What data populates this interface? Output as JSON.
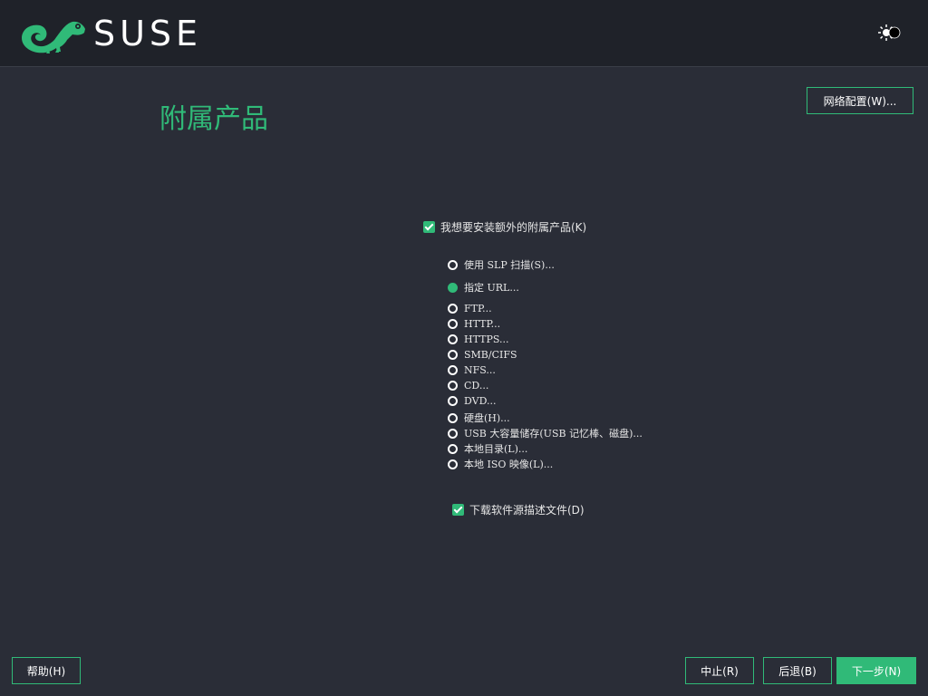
{
  "header": {
    "brand": "SUSE",
    "logo_icon": "chameleon-logo-icon",
    "theme_toggle_icon": "sun-moon-toggle-icon"
  },
  "page": {
    "title": "附属产品",
    "network_button": "网络配置(W)..."
  },
  "addon": {
    "install_checkbox": {
      "label": "我想要安装额外的附属产品(K)",
      "checked": true
    },
    "options_primary": [
      {
        "label": "使用 SLP 扫描(S)...",
        "selected": false
      },
      {
        "label": "指定 URL...",
        "selected": true
      }
    ],
    "options": [
      {
        "label": "FTP...",
        "selected": false
      },
      {
        "label": "HTTP...",
        "selected": false
      },
      {
        "label": "HTTPS...",
        "selected": false
      },
      {
        "label": "SMB/CIFS",
        "selected": false
      },
      {
        "label": "NFS...",
        "selected": false
      },
      {
        "label": "CD...",
        "selected": false
      },
      {
        "label": "DVD...",
        "selected": false
      },
      {
        "label": "硬盘(H)...",
        "selected": false
      },
      {
        "label": "USB 大容量储存(USB 记忆棒、磁盘)...",
        "selected": false
      },
      {
        "label": "本地目录(L)...",
        "selected": false
      },
      {
        "label": "本地 ISO 映像(L)...",
        "selected": false
      }
    ],
    "download_checkbox": {
      "label": "下载软件源描述文件(D)",
      "checked": true
    }
  },
  "footer": {
    "help": "帮助(H)",
    "abort": "中止(R)",
    "back": "后退(B)",
    "next": "下一步(N)"
  },
  "colors": {
    "accent": "#30ba78",
    "background": "#2a2d37",
    "header_bg": "#1f2229"
  }
}
